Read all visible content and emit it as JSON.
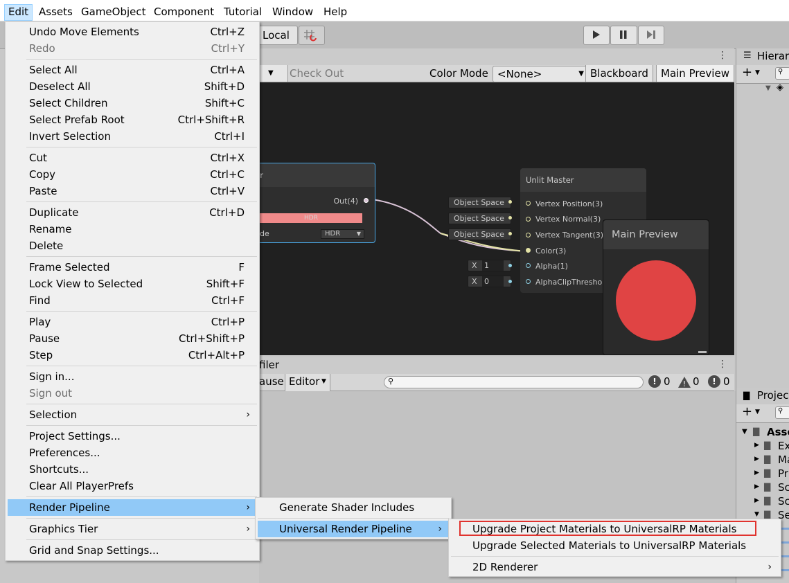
{
  "menubar": {
    "items": [
      "Edit",
      "Assets",
      "GameObject",
      "Component",
      "Tutorial",
      "Window",
      "Help"
    ]
  },
  "toolbar": {
    "local_label": "Local"
  },
  "shader_graph": {
    "check_out": "Check Out",
    "color_mode_label": "Color Mode",
    "color_mode_value": "<None>",
    "blackboard": "Blackboard",
    "main_preview": "Main Preview",
    "color_node": {
      "title_fragment": "lor",
      "out_port": "Out(4)",
      "hdr_bar": "HDR",
      "mode_fragment": "de",
      "mode_value": "HDR"
    },
    "master_node": {
      "title": "Unlit Master",
      "ports": [
        "Vertex Position(3)",
        "Vertex Normal(3)",
        "Vertex Tangent(3)",
        "Color(3)",
        "Alpha(1)",
        "AlphaClipThreshold"
      ]
    },
    "space_chips": [
      "Object Space",
      "Object Space",
      "Object Space"
    ],
    "value_chips": [
      {
        "axis": "X",
        "value": "1"
      },
      {
        "axis": "X",
        "value": "0"
      }
    ],
    "preview_panel": {
      "title": "Main Preview",
      "sphere_color": "#e04444"
    }
  },
  "hierarchy": {
    "title_fragment": "Hierar"
  },
  "project": {
    "title_fragment": "Projec",
    "assets_fragment": "Asse",
    "folders": [
      "Ex",
      "Ma",
      "Pr",
      "Sc",
      "Sc",
      "Se"
    ]
  },
  "profiler": {
    "title_fragment": "filer",
    "pause_fragment": "ause",
    "editor": "Editor",
    "counts": [
      "0",
      "0",
      "0"
    ]
  },
  "edit_menu": {
    "groups": [
      [
        {
          "label": "Undo Move Elements",
          "shortcut": "Ctrl+Z"
        },
        {
          "label": "Redo",
          "shortcut": "Ctrl+Y",
          "disabled": true
        }
      ],
      [
        {
          "label": "Select All",
          "shortcut": "Ctrl+A"
        },
        {
          "label": "Deselect All",
          "shortcut": "Shift+D"
        },
        {
          "label": "Select Children",
          "shortcut": "Shift+C"
        },
        {
          "label": "Select Prefab Root",
          "shortcut": "Ctrl+Shift+R"
        },
        {
          "label": "Invert Selection",
          "shortcut": "Ctrl+I"
        }
      ],
      [
        {
          "label": "Cut",
          "shortcut": "Ctrl+X"
        },
        {
          "label": "Copy",
          "shortcut": "Ctrl+C"
        },
        {
          "label": "Paste",
          "shortcut": "Ctrl+V"
        }
      ],
      [
        {
          "label": "Duplicate",
          "shortcut": "Ctrl+D"
        },
        {
          "label": "Rename",
          "shortcut": ""
        },
        {
          "label": "Delete",
          "shortcut": ""
        }
      ],
      [
        {
          "label": "Frame Selected",
          "shortcut": "F"
        },
        {
          "label": "Lock View to Selected",
          "shortcut": "Shift+F"
        },
        {
          "label": "Find",
          "shortcut": "Ctrl+F"
        }
      ],
      [
        {
          "label": "Play",
          "shortcut": "Ctrl+P"
        },
        {
          "label": "Pause",
          "shortcut": "Ctrl+Shift+P"
        },
        {
          "label": "Step",
          "shortcut": "Ctrl+Alt+P"
        }
      ],
      [
        {
          "label": "Sign in...",
          "shortcut": ""
        },
        {
          "label": "Sign out",
          "shortcut": "",
          "disabled": true
        }
      ],
      [
        {
          "label": "Selection",
          "shortcut": "",
          "submenu": true
        }
      ],
      [
        {
          "label": "Project Settings...",
          "shortcut": ""
        },
        {
          "label": "Preferences...",
          "shortcut": ""
        },
        {
          "label": "Shortcuts...",
          "shortcut": ""
        },
        {
          "label": "Clear All PlayerPrefs",
          "shortcut": ""
        }
      ],
      [
        {
          "label": "Render Pipeline",
          "shortcut": "",
          "submenu": true,
          "highlighted": true
        }
      ],
      [
        {
          "label": "Graphics Tier",
          "shortcut": "",
          "submenu": true
        }
      ],
      [
        {
          "label": "Grid and Snap Settings...",
          "shortcut": ""
        }
      ]
    ]
  },
  "render_pipeline_menu": {
    "items": [
      {
        "label": "Generate Shader Includes"
      },
      {
        "label": "Universal Render Pipeline",
        "submenu": true,
        "highlighted": true
      }
    ]
  },
  "urp_menu": {
    "items": [
      {
        "label": "Upgrade Project Materials to UniversalRP Materials",
        "boxed": true
      },
      {
        "label": "Upgrade Selected Materials to UniversalRP Materials"
      },
      {
        "label": "2D Renderer",
        "submenu": true
      }
    ]
  },
  "colors": {
    "menu_highlight": "#91c9f7",
    "annotation_red": "#e0332e"
  }
}
